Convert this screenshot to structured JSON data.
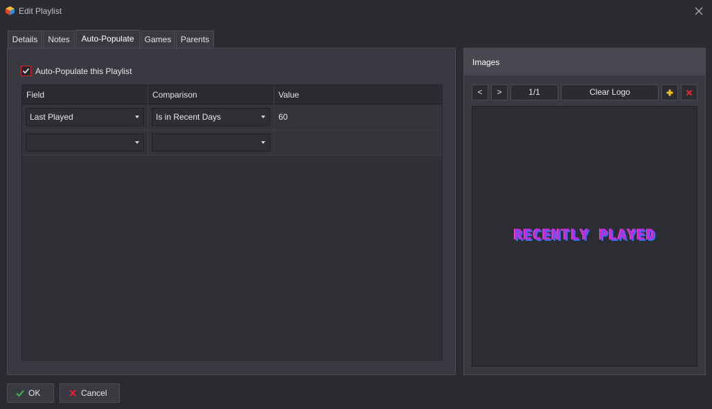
{
  "window": {
    "title": "Edit Playlist"
  },
  "tabs": [
    {
      "label": "Details",
      "active": false
    },
    {
      "label": "Notes",
      "active": false
    },
    {
      "label": "Auto-Populate",
      "active": true
    },
    {
      "label": "Games",
      "active": false
    },
    {
      "label": "Parents",
      "active": false
    }
  ],
  "auto_populate": {
    "checkbox_label": "Auto-Populate this Playlist",
    "checked": true,
    "columns": [
      "Field",
      "Comparison",
      "Value"
    ],
    "rows": [
      {
        "field": "Last Played",
        "comparison": "Is in Recent Days",
        "value": "60"
      },
      {
        "field": "",
        "comparison": "",
        "value": ""
      }
    ]
  },
  "images": {
    "title": "Images",
    "prev_label": "<",
    "next_label": ">",
    "counter": "1/1",
    "clear_label": "Clear Logo",
    "logo_text": "RECENTLY PLAYED"
  },
  "buttons": {
    "ok": "OK",
    "cancel": "Cancel"
  },
  "colors": {
    "accent_red": "#d4262d",
    "ok_green": "#3bbf4a",
    "add_yellow": "#f2c21a",
    "logo_purple": "#c02ae0",
    "logo_blue": "#3a6cf0"
  }
}
